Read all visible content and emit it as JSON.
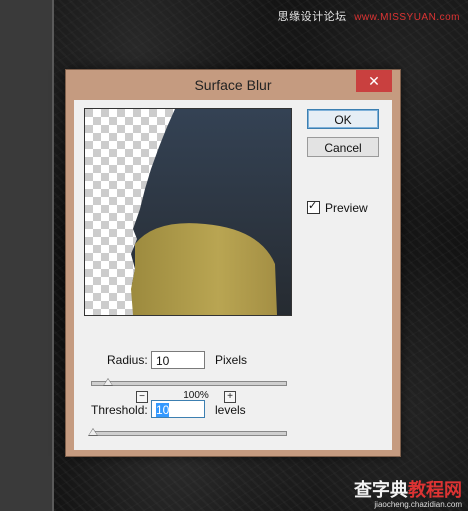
{
  "dialog": {
    "title": "Surface Blur",
    "close_glyph": "✕",
    "ok_label": "OK",
    "cancel_label": "Cancel",
    "preview_label": "Preview",
    "preview_checked": true,
    "zoom_out_glyph": "−",
    "zoom_in_glyph": "+",
    "zoom_level": "100%",
    "radius": {
      "label": "Radius:",
      "value": "10",
      "unit": "Pixels",
      "slider_fraction": 0.09
    },
    "threshold": {
      "label": "Threshold:",
      "value": "10",
      "unit": "levels",
      "slider_fraction": 0.01
    }
  },
  "watermarks": {
    "top_text": "思缘设计论坛",
    "top_site": "www.MISSYUAN.com",
    "bottom_big_1": "查字典",
    "bottom_big_2": "教程网",
    "bottom_site": "jiaocheng.chazidian.com"
  },
  "colors": {
    "dialog_frame": "#c59b80",
    "close_button": "#c9403f",
    "preview_dark": "#2c343c",
    "preview_yellow": "#b5a24f"
  },
  "icons": {
    "close": "close-icon",
    "zoom_out": "zoom-out-icon",
    "zoom_in": "zoom-in-icon",
    "checkmark": "checkmark-icon"
  }
}
